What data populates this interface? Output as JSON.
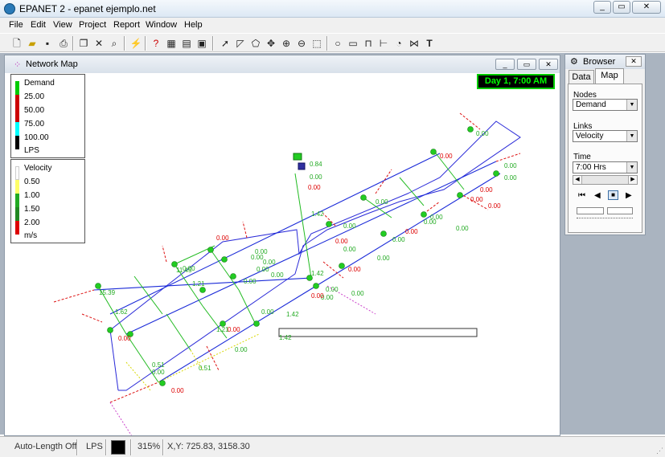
{
  "app": {
    "title": "EPANET 2 - epanet ejemplo.net",
    "icon": "epanet-icon",
    "window_controls": [
      "minimize-icon",
      "maximize-icon",
      "close-icon"
    ]
  },
  "menu": [
    "File",
    "Edit",
    "View",
    "Project",
    "Report",
    "Window",
    "Help"
  ],
  "toolbar": [
    "new-icon",
    "open-icon",
    "save-icon",
    "print-icon",
    "copy-icon",
    "delete-icon",
    "find-icon",
    "run-icon",
    "query-icon",
    "graph-icon",
    "table-icon",
    "options-icon",
    "select-icon",
    "vertex-icon",
    "region-icon",
    "pan-icon",
    "zoom-in-icon",
    "zoom-out-icon",
    "full-extent-icon",
    "junction-icon",
    "reservoir-icon",
    "tank-icon",
    "pipe-icon",
    "pump-icon",
    "valve-icon",
    "label-icon"
  ],
  "map_window": {
    "title": "Network Map",
    "clock": "Day 1, 7:00 AM"
  },
  "legend_nodes": {
    "title": "Demand",
    "entries": [
      "25.00",
      "50.00",
      "75.00",
      "100.00"
    ],
    "unit": "LPS",
    "colors": [
      "#00cc00",
      "#cc0000",
      "#cc0000",
      "#00ffff",
      "#000000"
    ]
  },
  "legend_links": {
    "title": "Velocity",
    "entries": [
      "0.50",
      "1.00",
      "1.50",
      "2.00"
    ],
    "unit": "m/s",
    "colors": [
      "#ffffff",
      "#ffff66",
      "#22aa22",
      "#228822",
      "#dd0000"
    ]
  },
  "map_labels": [
    "0.00",
    "0.00",
    "0.00",
    "0.00",
    "0.00",
    "0.00",
    "0.00",
    "0.00",
    "0.00",
    "0.00",
    "0.00",
    "0.00",
    "0.00",
    "0.00",
    "0.00",
    "0.00",
    "0.00",
    "0.00",
    "0.00",
    "0.00",
    "0.00",
    "0.00",
    "0.00",
    "0.00",
    "0.00",
    "0.00",
    "0.00",
    "0.00",
    "0.00",
    "0.00",
    "0.00",
    "0.00",
    "0.00",
    "0.00",
    "0.00",
    "0.00",
    "0.00",
    "0.00",
    "1.42",
    "1.42",
    "1.42",
    "1.42",
    "1.21",
    "1.21",
    "1.62",
    "11.45",
    "15.39",
    "0.51",
    "0.51",
    "0.84"
  ],
  "browser": {
    "title": "Browser",
    "tabs": [
      "Data",
      "Map"
    ],
    "nodes_label": "Nodes",
    "nodes_value": "Demand",
    "links_label": "Links",
    "links_value": "Velocity",
    "time_label": "Time",
    "time_value": "7:00 Hrs"
  },
  "status": {
    "auto_length": "Auto-Length Off",
    "units": "LPS",
    "zoom": "315%",
    "xy": "X,Y: 725.83, 3158.30"
  }
}
